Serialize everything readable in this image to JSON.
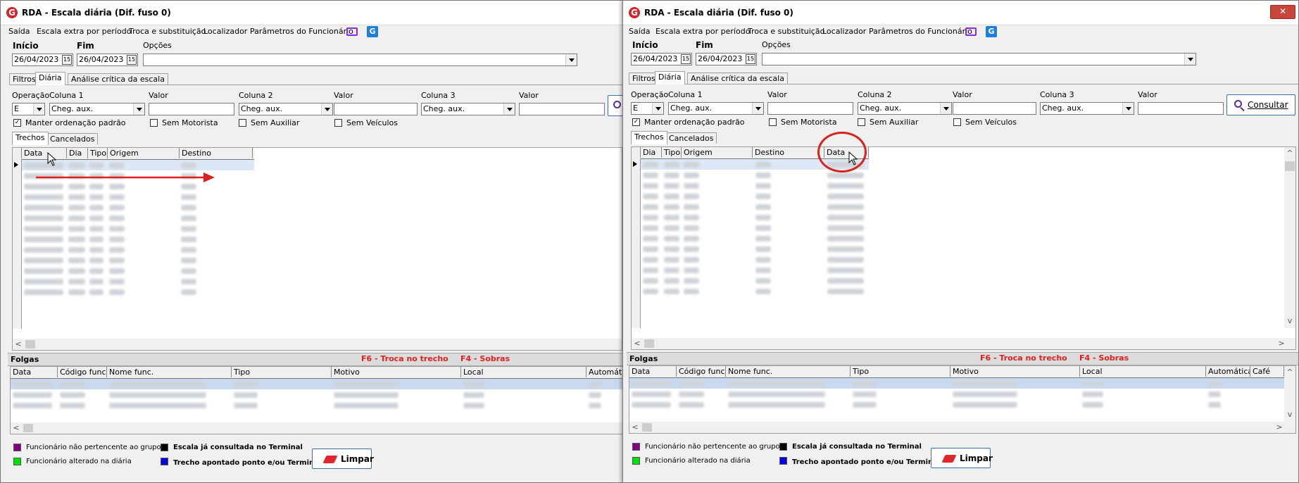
{
  "window": {
    "title": "RDA - Escala diária (Dif. fuso 0)",
    "close_glyph": "✕"
  },
  "menu": {
    "items": [
      "Saída",
      "Escala extra por período",
      "Troca e substituição",
      "Localizador",
      "Parâmetros do Funcionário"
    ],
    "icons": [
      "monitor-icon",
      "g-icon"
    ]
  },
  "dates": {
    "inicio_label": "Início",
    "fim_label": "Fim",
    "opcoes_label": "Opções",
    "inicio_value": "26/04/2023",
    "fim_value": "26/04/2023",
    "cal_glyph": "15",
    "opcoes_value": ""
  },
  "tabs_main": [
    "Filtros",
    "Diária",
    "Análise crítica da escala"
  ],
  "filters": {
    "operacao_label": "Operação",
    "operacao_value": "E",
    "coluna1_label": "Coluna 1",
    "coluna2_label": "Coluna 2",
    "coluna3_label": "Coluna 3",
    "valor_label": "Valor",
    "coluna_value": "Cheg. aux.",
    "manter_label": "Manter ordenação padrão",
    "manter_checked": true,
    "sem_motorista": "Sem Motorista",
    "sem_auxiliar": "Sem Auxiliar",
    "sem_veiculos": "Sem Veículos",
    "consultar_label": "Consultar"
  },
  "subtabs": [
    "Trechos",
    "Cancelados"
  ],
  "trechos_left": {
    "columns": [
      "Data",
      "Dia",
      "Tipo",
      "Origem",
      "Destino"
    ]
  },
  "trechos_right": {
    "columns": [
      "Dia",
      "Tipo",
      "Origem",
      "Destino",
      "Data"
    ]
  },
  "folgas": {
    "title": "Folgas",
    "hint_f6": "F6 - Troca no trecho",
    "hint_f4": "F4 - Sobras",
    "columns_left": [
      "Data",
      "Código func.",
      "Nome func.",
      "Tipo",
      "Motivo",
      "Local",
      "Automátic"
    ],
    "columns_right": [
      "Data",
      "Código func.",
      "Nome func.",
      "Tipo",
      "Motivo",
      "Local",
      "Automática",
      "Café"
    ]
  },
  "legend": {
    "nao_pertencente": "Funcionário não pertencente ao grupo",
    "alterado": "Funcionário alterado na diária",
    "consultada": "Escala já consultada no Terminal",
    "apontado": "Trecho apontado ponto e/ou Terminal",
    "colors": {
      "purple": "#800080",
      "green": "#00e000",
      "black": "#000000",
      "blue": "#0000e0"
    }
  },
  "limpar_label": "Limpar",
  "annotations": {
    "arrow_color": "#e02020",
    "circle_color": "#d8231b"
  }
}
